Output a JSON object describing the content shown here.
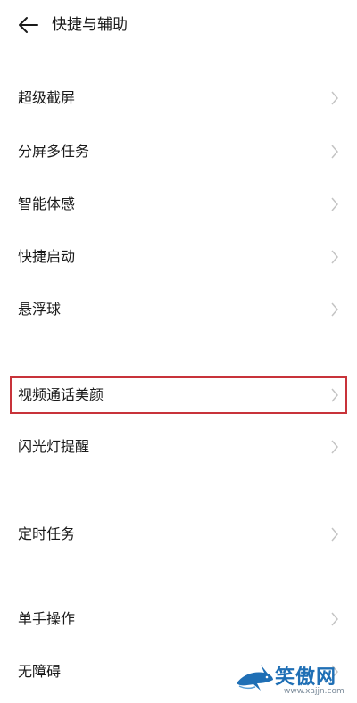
{
  "header": {
    "title": "快捷与辅助"
  },
  "items": [
    {
      "label": "超级截屏"
    },
    {
      "label": "分屏多任务"
    },
    {
      "label": "智能体感"
    },
    {
      "label": "快捷启动"
    },
    {
      "label": "悬浮球"
    },
    {
      "label": "视频通话美颜"
    },
    {
      "label": "闪光灯提醒"
    },
    {
      "label": "定时任务"
    },
    {
      "label": "单手操作"
    },
    {
      "label": "无障碍"
    }
  ],
  "watermark": {
    "text": "笑傲网",
    "url": "www.xajjn.com"
  },
  "colors": {
    "highlight": "#c8333a",
    "chevron": "#c4c4c4",
    "watermark": "#1f6fb5"
  }
}
